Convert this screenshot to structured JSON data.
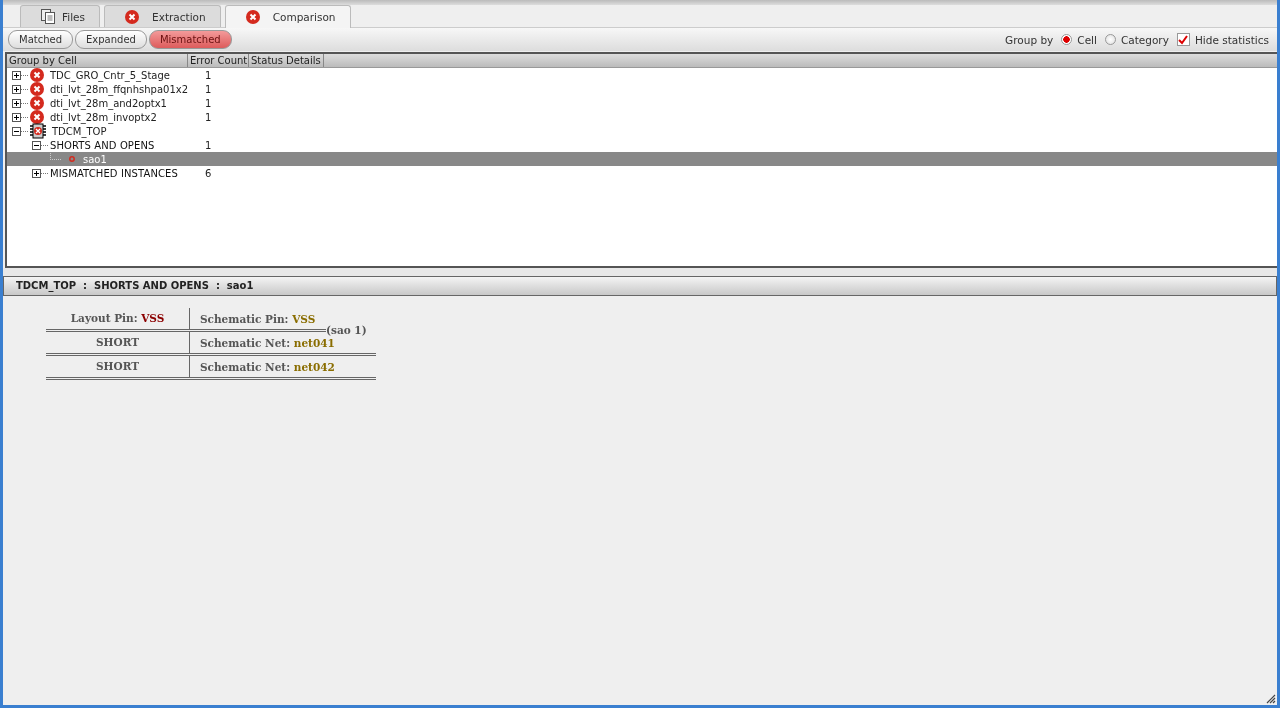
{
  "tabs": [
    {
      "label": "Files",
      "kind": "files",
      "selected": false
    },
    {
      "label": "Extraction",
      "kind": "error",
      "selected": false
    },
    {
      "label": "Comparison",
      "kind": "error",
      "selected": true
    }
  ],
  "filters": [
    {
      "label": "Matched",
      "selected": false
    },
    {
      "label": "Expanded",
      "selected": false
    },
    {
      "label": "Mismatched",
      "selected": true
    }
  ],
  "group_by": {
    "label": "Group by",
    "options": [
      {
        "label": "Cell",
        "selected": true
      },
      {
        "label": "Category",
        "selected": false
      }
    ]
  },
  "hide_statistics": {
    "label": "Hide statistics",
    "checked": true
  },
  "tree": {
    "columns": [
      "Group by Cell",
      "Error Count",
      "Status Details"
    ],
    "rows": [
      {
        "kind": "cell",
        "label": "TDC_GRO_Cntr_5_Stage",
        "count": "1",
        "expanded": false,
        "selected": false
      },
      {
        "kind": "cell",
        "label": "dti_lvt_28m_ffqnhshpa01x2",
        "count": "1",
        "expanded": false,
        "selected": false
      },
      {
        "kind": "cell",
        "label": "dti_lvt_28m_and2optx1",
        "count": "1",
        "expanded": false,
        "selected": false
      },
      {
        "kind": "cell",
        "label": "dti_lvt_28m_invoptx2",
        "count": "1",
        "expanded": false,
        "selected": false
      },
      {
        "kind": "chip",
        "label": "TDCM_TOP",
        "expanded": true,
        "selected": false,
        "children": [
          {
            "kind": "category",
            "label": "SHORTS AND OPENS",
            "count": "1",
            "expanded": true,
            "selected": false,
            "children": [
              {
                "kind": "item",
                "label": "sao1",
                "selected": true
              }
            ]
          },
          {
            "kind": "category",
            "label": "MISMATCHED INSTANCES",
            "count": "6",
            "expanded": false,
            "selected": false
          }
        ]
      }
    ]
  },
  "detail": {
    "title": "TDCM_TOP  :  SHORTS AND OPENS  :  sao1",
    "note": "(sao 1)",
    "rows": [
      {
        "left": {
          "label": "Layout Pin:",
          "value": "VSS",
          "kind": "layout"
        },
        "right": {
          "label": "Schematic Pin:",
          "value": "VSS",
          "kind": "schematic"
        }
      },
      {
        "left": {
          "label": "SHORT"
        },
        "right": {
          "label": "Schematic Net:",
          "value": "net041",
          "kind": "schematic"
        }
      },
      {
        "left": {
          "label": "SHORT"
        },
        "right": {
          "label": "Schematic Net:",
          "value": "net042",
          "kind": "schematic"
        }
      }
    ]
  }
}
